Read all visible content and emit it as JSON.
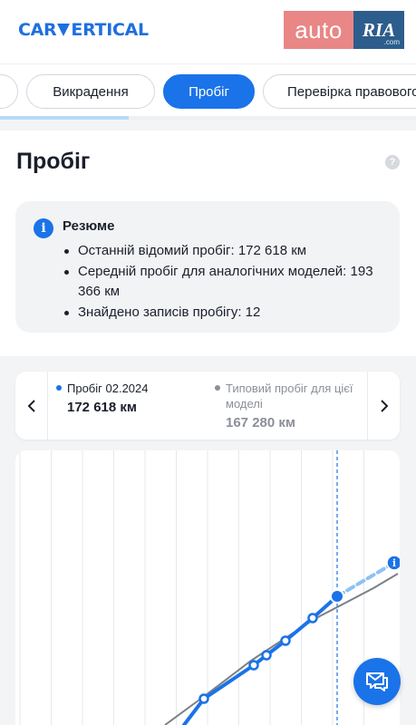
{
  "header": {
    "logo": {
      "left": "CAR",
      "right": "ERTICAL"
    },
    "partner": {
      "auto": "auto",
      "ria": "RIA",
      "ria_suffix": ".com"
    }
  },
  "tabs": [
    {
      "label": "Викрадення",
      "active": false
    },
    {
      "label": "Пробіг",
      "active": true
    },
    {
      "label": "Перевірка правового статусу",
      "active": false
    }
  ],
  "tab_scroll_progress": 0.31,
  "section": {
    "title": "Пробіг",
    "help": "?",
    "summary": {
      "title": "Резюме",
      "items": [
        "Останній відомий пробіг: 172 618 км",
        "Середній пробіг для аналогічних моделей: 193 366 км",
        "Знайдено записів пробігу: 12"
      ]
    }
  },
  "stats": {
    "record": {
      "label": "Пробіг 02.2024",
      "value": "172 618 км"
    },
    "typical": {
      "label": "Типовий пробіг для цієї моделі",
      "value": "167 280 км"
    }
  },
  "colors": {
    "accent": "#1a73e8",
    "brand": "#1e6fe0",
    "typical_line": "#7b7f86",
    "projection": "#8fc1f3",
    "grid": "#e6e8ec"
  },
  "icons": {
    "info": "info-icon",
    "help": "question-icon",
    "prev": "chevron-left-icon",
    "next": "chevron-right-icon",
    "chat": "chat-icon"
  }
}
